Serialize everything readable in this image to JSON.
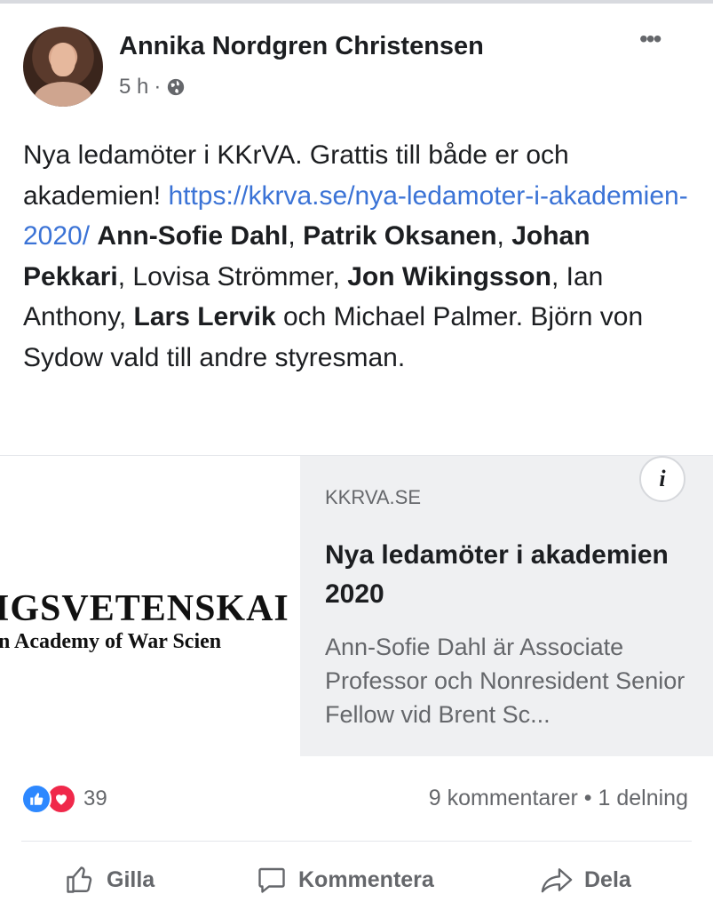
{
  "post": {
    "author": "Annika Nordgren Christensen",
    "time": "5 h",
    "privacy_separator": "·",
    "more_label": "•••",
    "text_intro": "Nya ledamöter i KKrVA. Grattis till både er och akademien!",
    "link_url": "https://kkrva.se/nya-ledamoter-i-akademien-2020/",
    "names": {
      "n1": "Ann-Sofie Dahl",
      "sep1": ", ",
      "n2": "Patrik Oksanen",
      "sep2": ", ",
      "n3": "Johan Pekkari",
      "sep3": ", Lovisa Strömmer, ",
      "n4": "Jon Wikingsson",
      "sep4": ", Ian Anthony, ",
      "n5": "Lars Lervik",
      "tail": " och Michael Palmer. Björn von Sydow vald till andre styresman."
    }
  },
  "preview": {
    "image_line1": "IGSVETENSKAI",
    "image_line2": "n Academy of War Scien",
    "domain": "KKRVA.SE",
    "title": "Nya ledamöter i akademien 2020",
    "description": "Ann-Sofie Dahl är Associate Professor och Nonresident Senior Fellow vid Brent Sc...",
    "info_label": "i"
  },
  "engagement": {
    "reaction_count": "39",
    "stats": "9 kommentarer • 1 delning"
  },
  "actions": {
    "like": "Gilla",
    "comment": "Kommentera",
    "share": "Dela"
  },
  "colors": {
    "link": "#3b73d6",
    "like": "#2d88ff",
    "love": "#f0284a",
    "muted": "#65676b"
  }
}
